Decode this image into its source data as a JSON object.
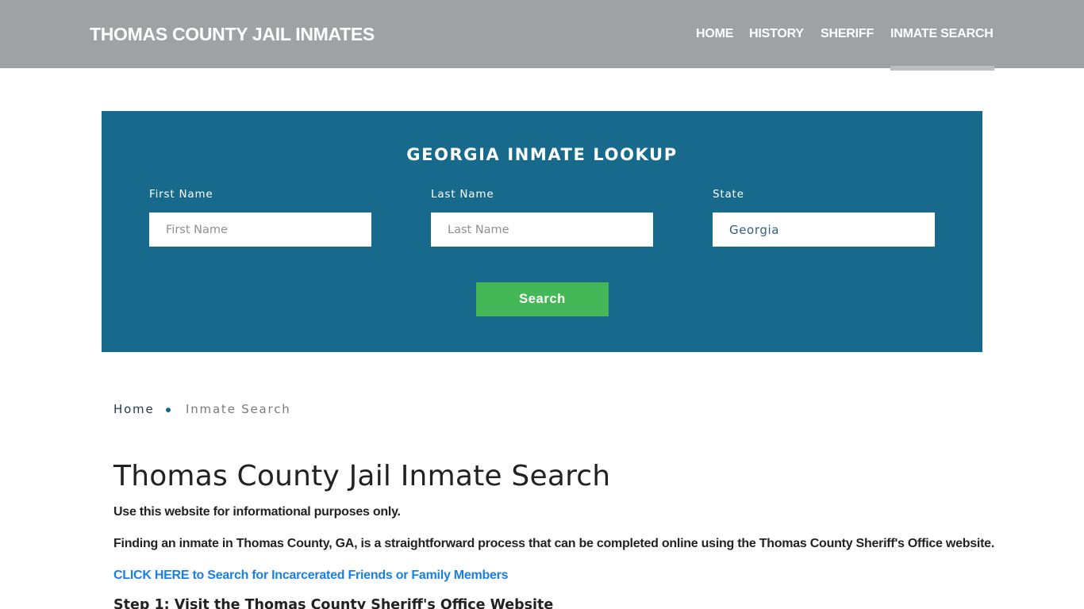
{
  "header": {
    "brand": "THOMAS COUNTY JAIL INMATES",
    "nav": [
      {
        "label": "HOME",
        "active": false
      },
      {
        "label": "HISTORY",
        "active": false
      },
      {
        "label": "SHERIFF",
        "active": false
      },
      {
        "label": "INMATE SEARCH",
        "active": true
      }
    ]
  },
  "lookup": {
    "title": "GEORGIA INMATE LOOKUP",
    "first_name": {
      "label": "First Name",
      "placeholder": "First Name",
      "value": ""
    },
    "last_name": {
      "label": "Last Name",
      "placeholder": "Last Name",
      "value": ""
    },
    "state": {
      "label": "State",
      "value": "Georgia"
    },
    "search_label": "Search"
  },
  "breadcrumb": {
    "home": "Home",
    "current": "Inmate Search"
  },
  "content": {
    "title": "Thomas County Jail Inmate Search",
    "paragraphs": [
      "Use this website for informational purposes only.",
      "Finding an inmate in Thomas County, GA, is a straightforward process that can be completed online using the Thomas County Sheriff's Office website."
    ],
    "cta_link": "CLICK HERE to Search for Incarcerated Friends or Family Members",
    "step1_heading": "Step 1: Visit the Thomas County Sheriff's Office Website"
  },
  "colors": {
    "header_bg": "#9ea2a5",
    "lookup_bg": "#176a8c",
    "search_button": "#44b757",
    "link": "#1a7fe0"
  }
}
